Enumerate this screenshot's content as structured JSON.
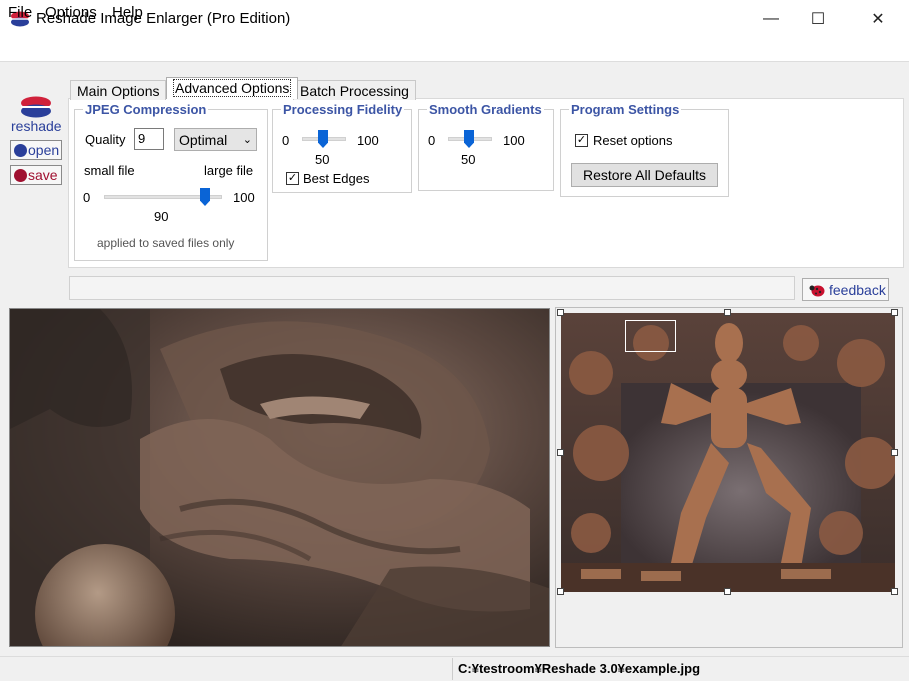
{
  "window": {
    "title": "Reshade Image Enlarger (Pro Edition)",
    "controls": {
      "minimize": "—",
      "maximize": "☐",
      "close": "✕"
    }
  },
  "menu": [
    "File",
    "Options",
    "Help"
  ],
  "sidebar": {
    "logo_text": "reshade",
    "open_label": "open",
    "save_label": "save"
  },
  "tabs": [
    {
      "label": "Main Options",
      "active": false
    },
    {
      "label": "Advanced Options",
      "active": true
    },
    {
      "label": "Batch Processing",
      "active": false
    }
  ],
  "jpeg": {
    "title": "JPEG Compression",
    "quality_label": "Quality",
    "quality_value": "9",
    "mode_value": "Optimal",
    "small_label": "small file",
    "large_label": "large file",
    "min": "0",
    "max": "100",
    "value": "90",
    "note": "applied to saved files only"
  },
  "fidelity": {
    "title": "Processing Fidelity",
    "min": "0",
    "max": "100",
    "value": "50",
    "checkbox_label": "Best Edges",
    "checked": true
  },
  "gradients": {
    "title": "Smooth Gradients",
    "min": "0",
    "max": "100",
    "value": "50"
  },
  "program": {
    "title": "Program Settings",
    "checkbox_label": "Reset options",
    "checked": true,
    "restore_label": "Restore All Defaults"
  },
  "feedback_label": "feedback",
  "status_path": "C:¥testroom¥Reshade 3.0¥example.jpg",
  "icons": {
    "app": "reshade-logo-icon",
    "open": "open-icon",
    "save": "save-icon",
    "feedback": "ladybug-icon",
    "dropdown": "chevron-down-icon"
  },
  "colors": {
    "accent": "#3c55a5",
    "slider": "#0a64d6",
    "logo_red": "#d0213b",
    "logo_blue": "#2a3f9a"
  }
}
